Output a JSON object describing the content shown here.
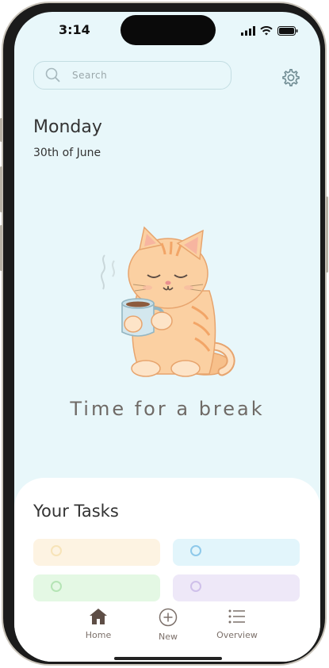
{
  "status": {
    "time": "3:14"
  },
  "search": {
    "placeholder": "Search"
  },
  "header": {
    "day": "Monday",
    "date": "30th of June"
  },
  "hero": {
    "message": "Time for a break"
  },
  "tasks": {
    "title": "Your Tasks",
    "items": [
      {
        "bg": "#fdf3e2",
        "ring": "#f7e3b8"
      },
      {
        "bg": "#e2f5fb",
        "ring": "#8ec9ea"
      },
      {
        "bg": "#e4f8e4",
        "ring": "#b5e4b5"
      },
      {
        "bg": "#eee8f8",
        "ring": "#cfc0ea"
      }
    ]
  },
  "nav": {
    "home": "Home",
    "new": "New",
    "overview": "Overview"
  },
  "colors": {
    "background": "#e8f7fa",
    "text": "#333333",
    "nav_text": "#7c706a"
  }
}
